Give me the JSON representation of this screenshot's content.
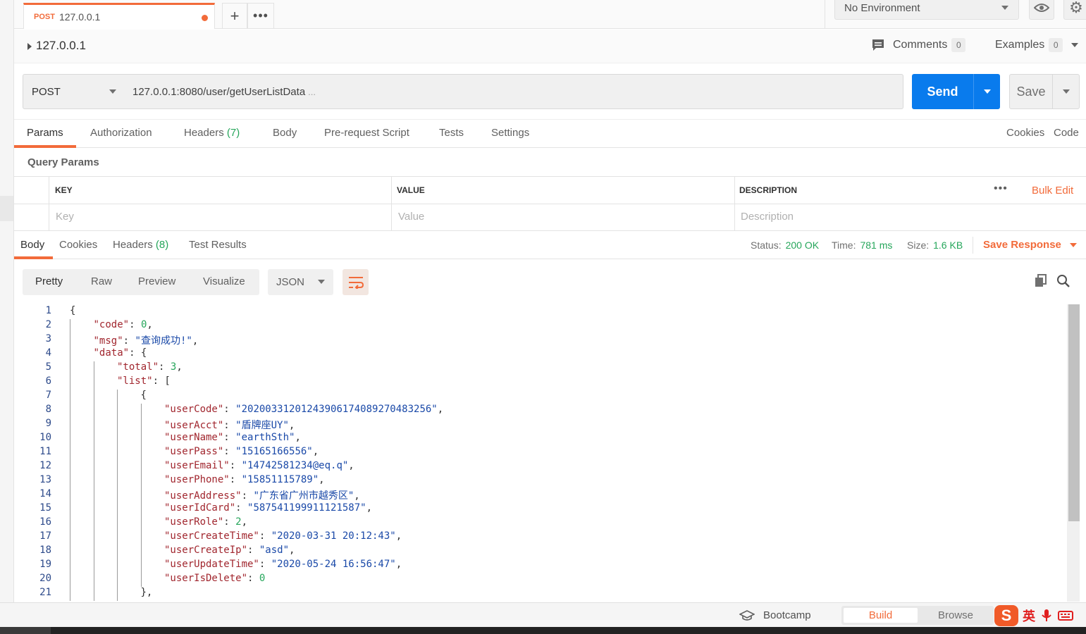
{
  "tab": {
    "method": "POST",
    "name": "127.0.0.1"
  },
  "environment": {
    "selected": "No Environment"
  },
  "request": {
    "title": "127.0.0.1",
    "comments_label": "Comments",
    "comments_count": "0",
    "examples_label": "Examples",
    "examples_count": "0",
    "method": "POST",
    "url": "127.0.0.1:8080/user/getUserListData",
    "url_ellipsis": "...",
    "send_label": "Send",
    "save_label": "Save"
  },
  "request_tabs": {
    "params": "Params",
    "authorization": "Authorization",
    "headers": "Headers",
    "headers_count": "(7)",
    "body": "Body",
    "prerequest": "Pre-request Script",
    "tests": "Tests",
    "settings": "Settings",
    "cookies": "Cookies",
    "code": "Code"
  },
  "query_params": {
    "title": "Query Params",
    "col_key": "KEY",
    "col_value": "VALUE",
    "col_description": "DESCRIPTION",
    "bulk_edit": "Bulk Edit",
    "key_placeholder": "Key",
    "value_placeholder": "Value",
    "description_placeholder": "Description"
  },
  "response": {
    "tabs": {
      "body": "Body",
      "cookies": "Cookies",
      "headers": "Headers",
      "headers_count": "(8)",
      "test_results": "Test Results"
    },
    "status_label": "Status:",
    "status_value": "200 OK",
    "time_label": "Time:",
    "time_value": "781 ms",
    "size_label": "Size:",
    "size_value": "1.6 KB",
    "save_response": "Save Response",
    "views": {
      "pretty": "Pretty",
      "raw": "Raw",
      "preview": "Preview",
      "visualize": "Visualize"
    },
    "format": "JSON"
  },
  "code_lines": [
    {
      "n": "1",
      "i": 0,
      "t": [
        [
          "p",
          "{"
        ]
      ]
    },
    {
      "n": "2",
      "i": 1,
      "t": [
        [
          "k",
          "\"code\""
        ],
        [
          "p",
          ": "
        ],
        [
          "n",
          "0"
        ],
        [
          "p",
          ","
        ]
      ]
    },
    {
      "n": "3",
      "i": 1,
      "t": [
        [
          "k",
          "\"msg\""
        ],
        [
          "p",
          ": "
        ],
        [
          "s",
          "\"查询成功!\""
        ],
        [
          "p",
          ","
        ]
      ]
    },
    {
      "n": "4",
      "i": 1,
      "t": [
        [
          "k",
          "\"data\""
        ],
        [
          "p",
          ": {"
        ]
      ]
    },
    {
      "n": "5",
      "i": 2,
      "t": [
        [
          "k",
          "\"total\""
        ],
        [
          "p",
          ": "
        ],
        [
          "n",
          "3"
        ],
        [
          "p",
          ","
        ]
      ]
    },
    {
      "n": "6",
      "i": 2,
      "t": [
        [
          "k",
          "\"list\""
        ],
        [
          "p",
          ": ["
        ]
      ]
    },
    {
      "n": "7",
      "i": 3,
      "t": [
        [
          "p",
          "{"
        ]
      ]
    },
    {
      "n": "8",
      "i": 4,
      "t": [
        [
          "k",
          "\"userCode\""
        ],
        [
          "p",
          ": "
        ],
        [
          "s",
          "\"20200331201243906174089270483256\""
        ],
        [
          "p",
          ","
        ]
      ]
    },
    {
      "n": "9",
      "i": 4,
      "t": [
        [
          "k",
          "\"userAcct\""
        ],
        [
          "p",
          ": "
        ],
        [
          "s",
          "\"盾牌座UY\""
        ],
        [
          "p",
          ","
        ]
      ]
    },
    {
      "n": "10",
      "i": 4,
      "t": [
        [
          "k",
          "\"userName\""
        ],
        [
          "p",
          ": "
        ],
        [
          "s",
          "\"earthSth\""
        ],
        [
          "p",
          ","
        ]
      ]
    },
    {
      "n": "11",
      "i": 4,
      "t": [
        [
          "k",
          "\"userPass\""
        ],
        [
          "p",
          ": "
        ],
        [
          "s",
          "\"15165166556\""
        ],
        [
          "p",
          ","
        ]
      ]
    },
    {
      "n": "12",
      "i": 4,
      "t": [
        [
          "k",
          "\"userEmail\""
        ],
        [
          "p",
          ": "
        ],
        [
          "s",
          "\"14742581234@eq.q\""
        ],
        [
          "p",
          ","
        ]
      ]
    },
    {
      "n": "13",
      "i": 4,
      "t": [
        [
          "k",
          "\"userPhone\""
        ],
        [
          "p",
          ": "
        ],
        [
          "s",
          "\"15851115789\""
        ],
        [
          "p",
          ","
        ]
      ]
    },
    {
      "n": "14",
      "i": 4,
      "t": [
        [
          "k",
          "\"userAddress\""
        ],
        [
          "p",
          ": "
        ],
        [
          "s",
          "\"广东省广州市越秀区\""
        ],
        [
          "p",
          ","
        ]
      ]
    },
    {
      "n": "15",
      "i": 4,
      "t": [
        [
          "k",
          "\"userIdCard\""
        ],
        [
          "p",
          ": "
        ],
        [
          "s",
          "\"587541199911121587\""
        ],
        [
          "p",
          ","
        ]
      ]
    },
    {
      "n": "16",
      "i": 4,
      "t": [
        [
          "k",
          "\"userRole\""
        ],
        [
          "p",
          ": "
        ],
        [
          "n",
          "2"
        ],
        [
          "p",
          ","
        ]
      ]
    },
    {
      "n": "17",
      "i": 4,
      "t": [
        [
          "k",
          "\"userCreateTime\""
        ],
        [
          "p",
          ": "
        ],
        [
          "s",
          "\"2020-03-31 20:12:43\""
        ],
        [
          "p",
          ","
        ]
      ]
    },
    {
      "n": "18",
      "i": 4,
      "t": [
        [
          "k",
          "\"userCreateIp\""
        ],
        [
          "p",
          ": "
        ],
        [
          "s",
          "\"asd\""
        ],
        [
          "p",
          ","
        ]
      ]
    },
    {
      "n": "19",
      "i": 4,
      "t": [
        [
          "k",
          "\"userUpdateTime\""
        ],
        [
          "p",
          ": "
        ],
        [
          "s",
          "\"2020-05-24 16:56:47\""
        ],
        [
          "p",
          ","
        ]
      ]
    },
    {
      "n": "20",
      "i": 4,
      "t": [
        [
          "k",
          "\"userIsDelete\""
        ],
        [
          "p",
          ": "
        ],
        [
          "n",
          "0"
        ]
      ]
    },
    {
      "n": "21",
      "i": 3,
      "t": [
        [
          "p",
          "},"
        ]
      ]
    }
  ],
  "statusbar": {
    "bootcamp": "Bootcamp",
    "build": "Build",
    "browse": "Browse"
  },
  "ime": {
    "logo": "S",
    "lang": "英"
  },
  "colors": {
    "accent": "#f26b3a",
    "send": "#097bed",
    "success": "#26a65b"
  }
}
